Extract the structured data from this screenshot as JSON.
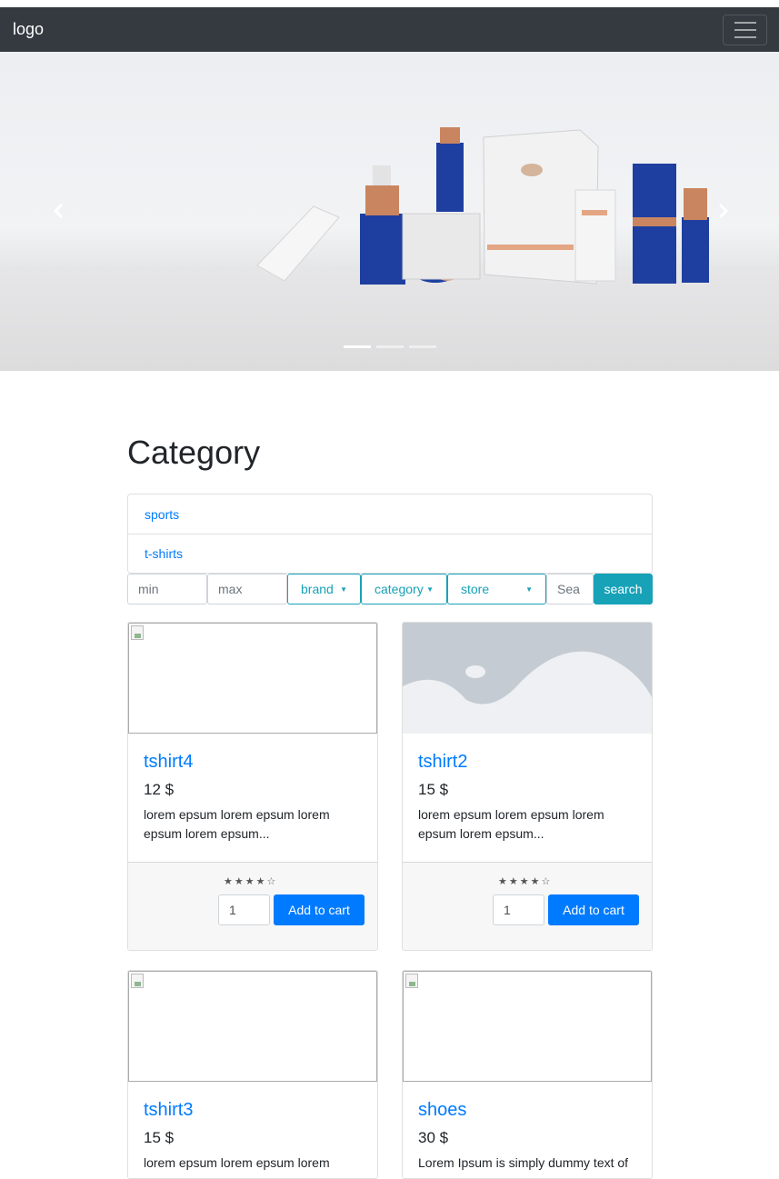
{
  "navbar": {
    "brand": "logo",
    "toggler_icon": "hamburger-icon"
  },
  "carousel": {
    "prev_icon": "chevron-left-icon",
    "next_icon": "chevron-right-icon",
    "slides_count": 3,
    "active_slide": 1
  },
  "category": {
    "title": "Category",
    "items": [
      {
        "label": "sports"
      },
      {
        "label": "t-shirts"
      }
    ]
  },
  "filters": {
    "min_placeholder": "min",
    "max_placeholder": "max",
    "brand_label": "brand",
    "category_label": "category",
    "store_label": "store",
    "search_placeholder": "Sea",
    "search_button": "search"
  },
  "products": [
    {
      "name": "tshirt4",
      "price": "12 $",
      "description": "lorem epsum lorem epsum lorem epsum lorem epsum...",
      "rating": 4,
      "quantity": "1",
      "add_label": "Add to cart"
    },
    {
      "name": "tshirt2",
      "price": "15 $",
      "description": "lorem epsum lorem epsum lorem epsum lorem epsum...",
      "rating": 4,
      "quantity": "1",
      "add_label": "Add to cart"
    },
    {
      "name": "tshirt3",
      "price": "15 $",
      "description": "lorem epsum lorem epsum lorem"
    },
    {
      "name": "shoes",
      "price": "30 $",
      "description": "Lorem Ipsum is simply dummy text of"
    }
  ],
  "colors": {
    "navbar": "#343a40",
    "primary": "#007bff",
    "info": "#17a2b8"
  }
}
